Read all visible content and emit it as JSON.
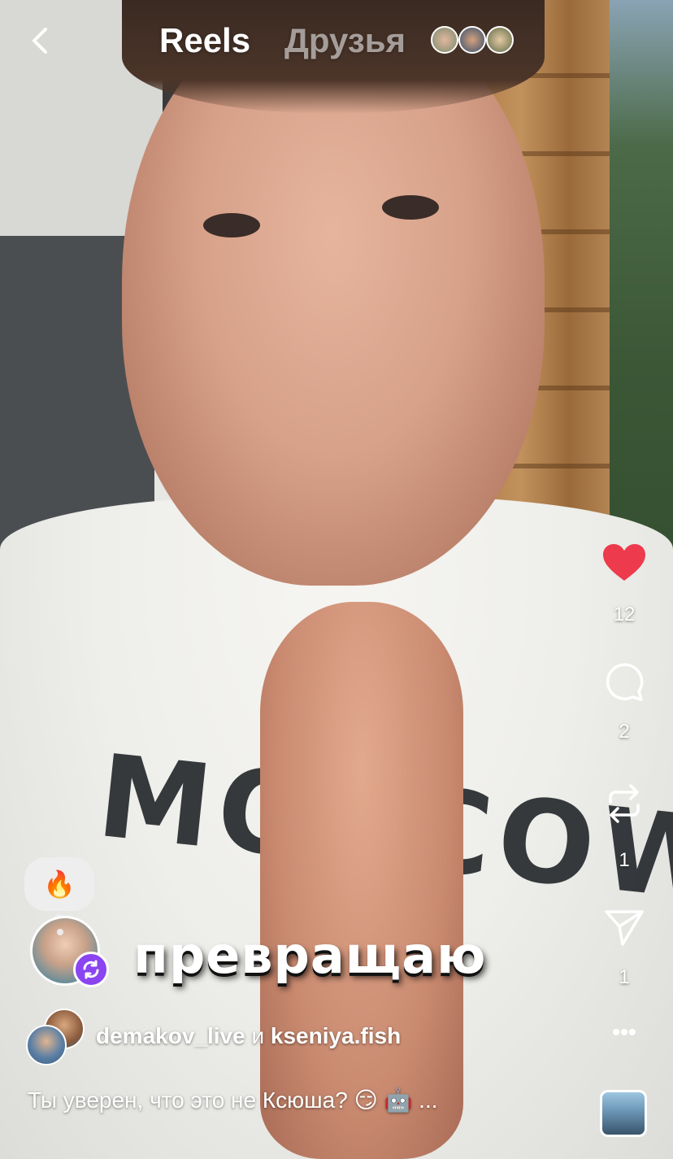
{
  "header": {
    "back_label": "Back",
    "tab_reels": "Reels",
    "tab_friends": "Друзья"
  },
  "actions": {
    "likes": "12",
    "comments": "2",
    "reposts": "1",
    "shares": "1"
  },
  "reaction_emoji": "🔥",
  "caption_overlay": "превращаю",
  "shirt_print": "MOSCOW",
  "authors": {
    "primary": "demakov_live",
    "conjunction": "и",
    "secondary": "kseniya.fish"
  },
  "description": "Ты уверен, что это не Ксюша? 😏 🤖  ...",
  "more_label": "•••",
  "colors": {
    "like_red": "#ED3A4C",
    "remix_purple": "#8A44F0",
    "text_white": "#FFFFFF"
  }
}
